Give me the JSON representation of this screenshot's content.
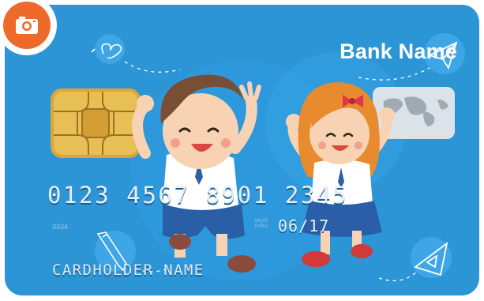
{
  "card": {
    "bank_name": "Bank Name",
    "number": "0123 4567 8901 2345",
    "small_number": "3334",
    "valid_thru": "VALID THRU",
    "expiry": "06/17",
    "holder": "CARDHOLDER NAME"
  },
  "colors": {
    "card_background": "#2b95d6",
    "badge_orange": "#ee6a2a",
    "chip_gold": "#d8a63a"
  },
  "icons": [
    "camera-icon",
    "butterfly-icon",
    "paper-plane-icon",
    "pencil-icon",
    "triangle-ruler-icon",
    "world-hologram-icon",
    "emv-chip-icon"
  ]
}
